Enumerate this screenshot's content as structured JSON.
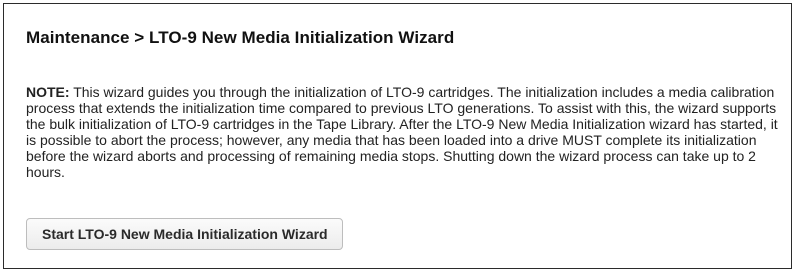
{
  "page": {
    "title": "Maintenance > LTO-9 New Media Initialization Wizard"
  },
  "note": {
    "label": "NOTE:",
    "text": " This wizard guides you through the initialization of LTO-9 cartridges. The initialization includes a media calibration process that extends the initialization time compared to previous LTO generations. To assist with this, the wizard supports the bulk initialization of LTO-9 cartridges in the Tape Library. After the LTO-9 New Media Initialization wizard has started, it is possible to abort the process; however, any media that has been loaded into a drive MUST complete its initialization before the wizard aborts and processing of remaining media stops. Shutting down the wizard process can take up to 2 hours."
  },
  "actions": {
    "start_label": "Start LTO-9 New Media Initialization Wizard"
  }
}
